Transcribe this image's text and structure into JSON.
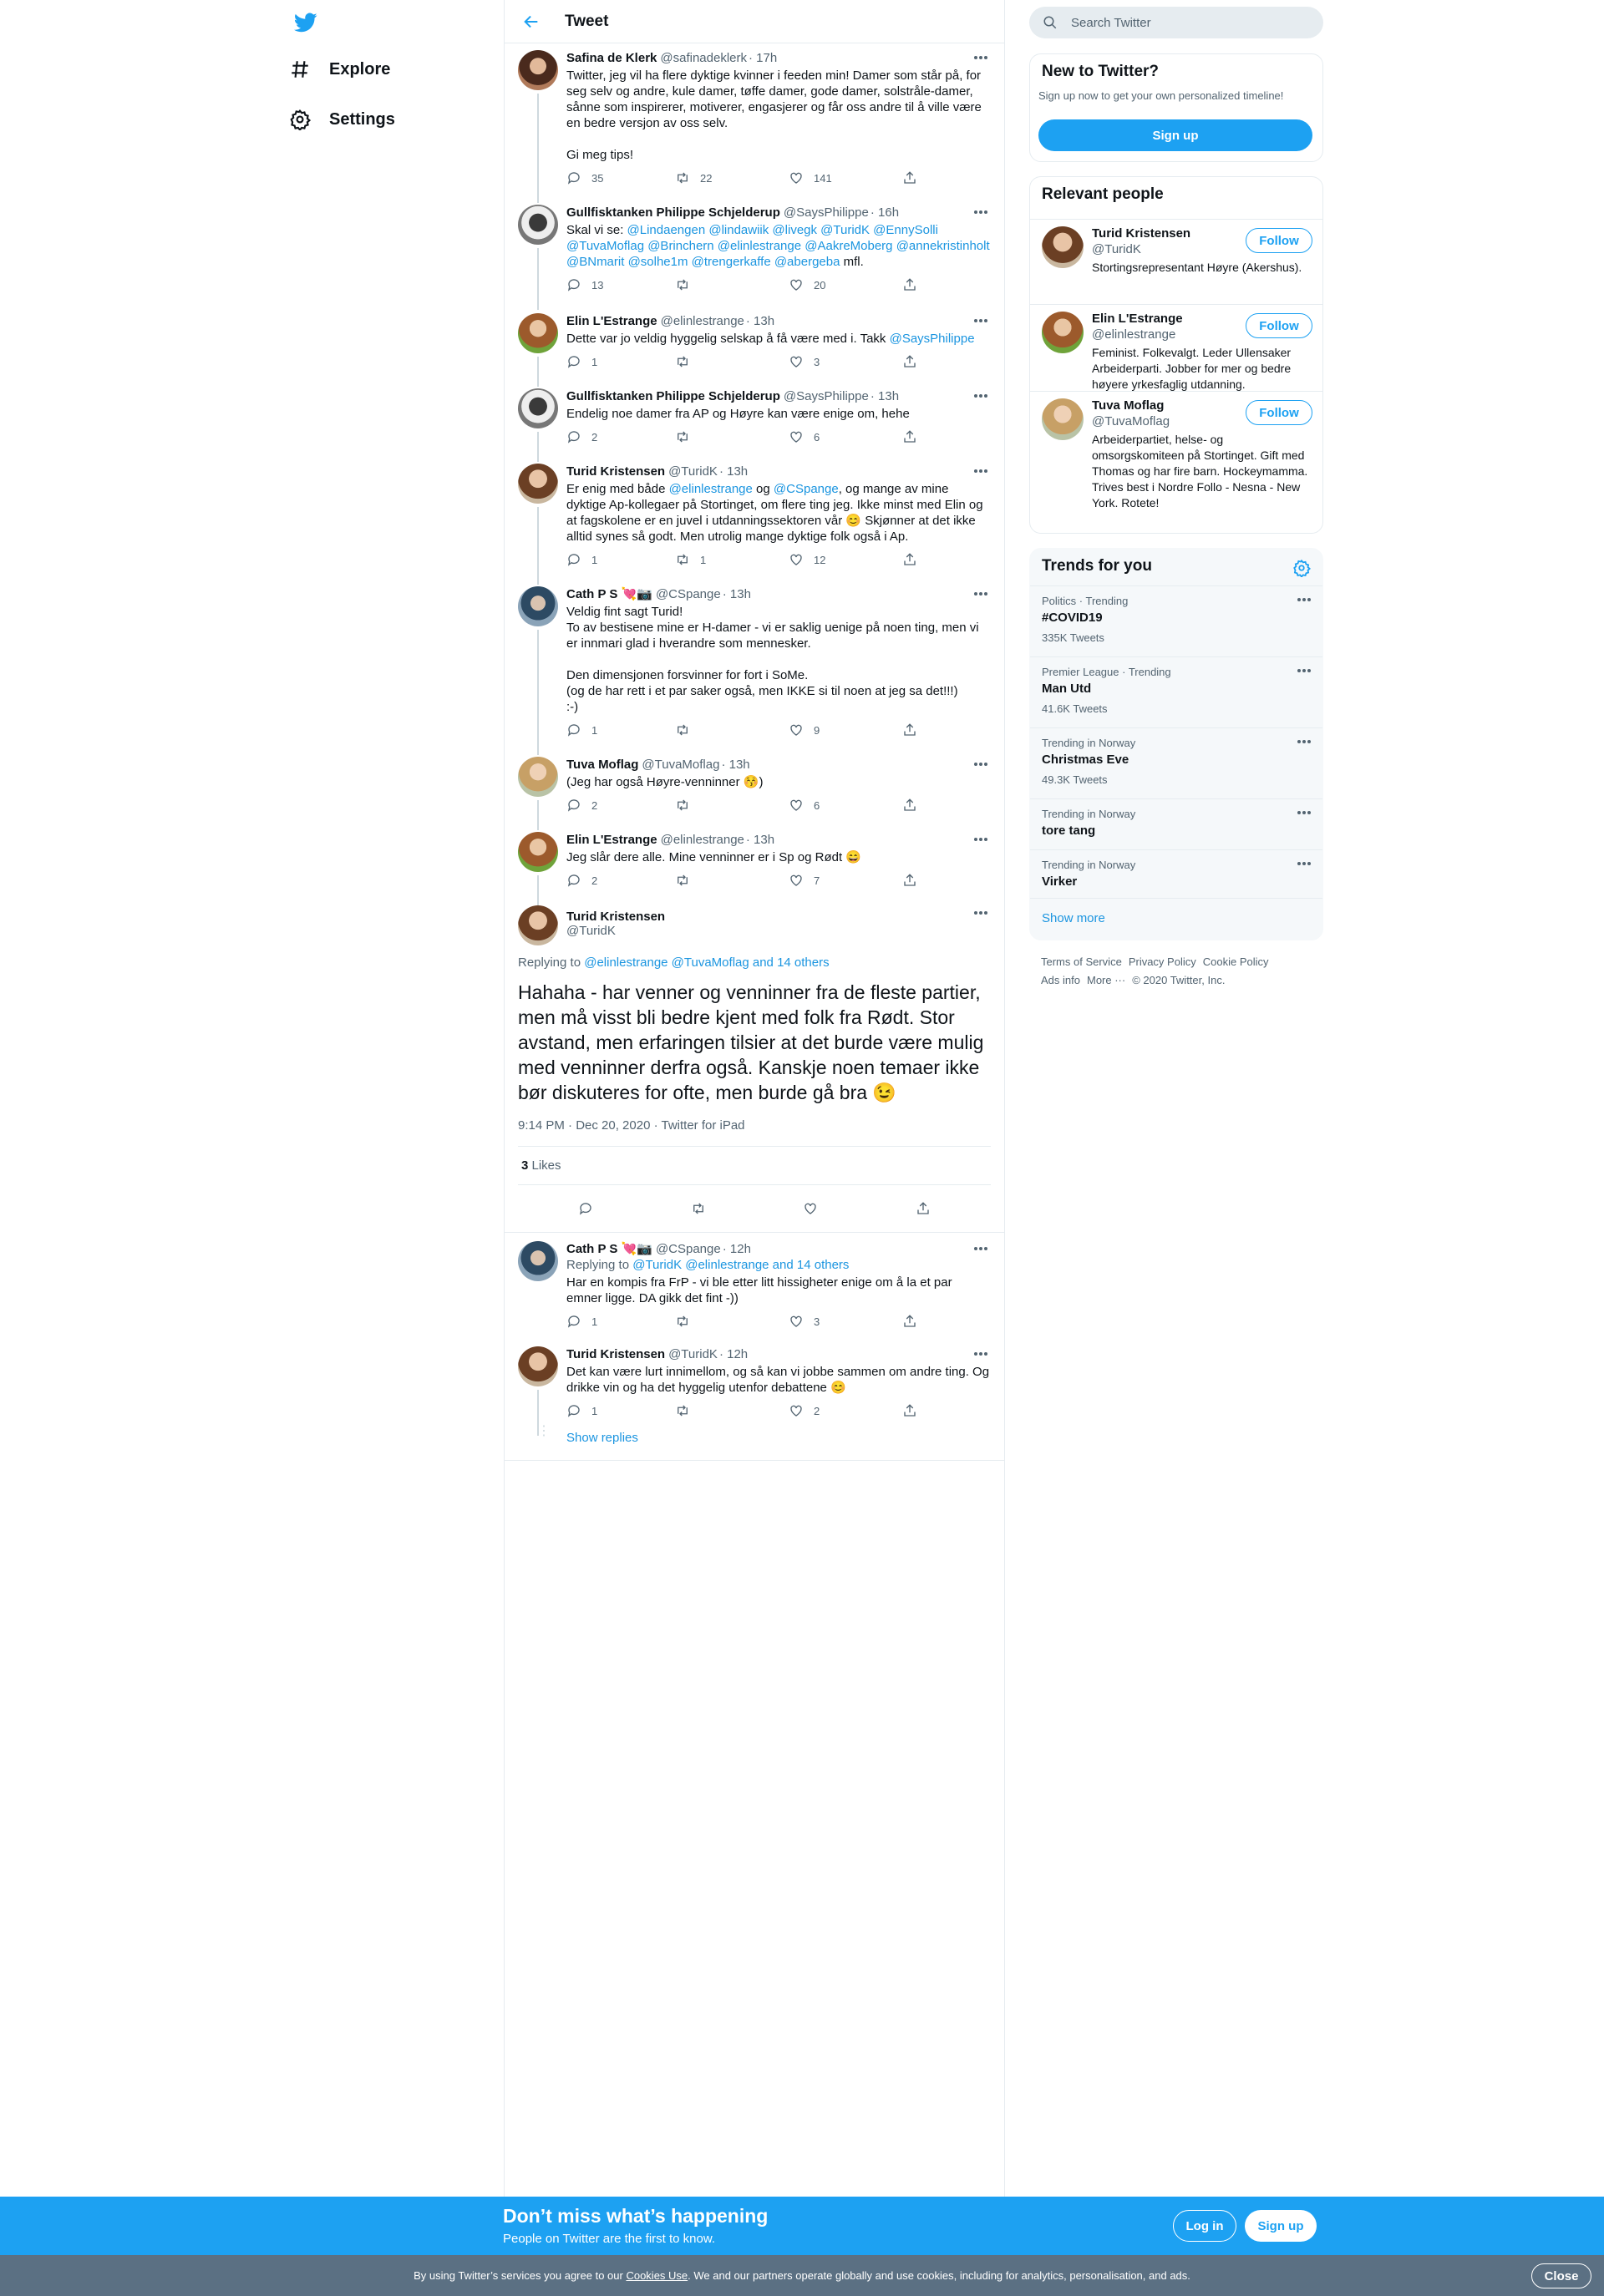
{
  "nav": {
    "explore": "Explore",
    "settings": "Settings"
  },
  "header": {
    "title": "Tweet"
  },
  "thread": [
    {
      "name": "Safina de Klerk",
      "handle": "@safinadeklerk",
      "time": "· 17h",
      "text": "Twitter, jeg vil ha flere dyktige kvinner i feeden min! Damer som står på, for seg selv og andre, kule damer, tøffe damer, gode damer, solstråle-damer, sånne som inspirerer, motiverer, engasjerer og får oss andre til å ville være en bedre versjon av oss selv.\n\nGi meg tips!",
      "replies": "35",
      "retweets": "22",
      "likes": "141"
    },
    {
      "name": "Gullfisktanken Philippe Schjelderup",
      "handle": "@SaysPhilippe",
      "time": "· 16h",
      "text_pre": "Skal vi se: ",
      "text_links": "@Lindaengen @lindawiik @livegk @TuridK @EnnySolli @TuvaMoflag @Brinchern @elinlestrange @AakreMoberg @annekristinholt @BNmarit @solhe1m @trengerkaffe @abergeba",
      "text_post": " mfl.",
      "replies": "13",
      "retweets": "",
      "likes": "20"
    },
    {
      "name": "Elin L'Estrange",
      "handle": "@elinlestrange",
      "time": "· 13h",
      "text_pre": "Dette var jo veldig hyggelig selskap å få være med i. Takk ",
      "text_link": "@SaysPhilippe",
      "replies": "1",
      "retweets": "",
      "likes": "3"
    },
    {
      "name": "Gullfisktanken Philippe Schjelderup",
      "handle": "@SaysPhilippe",
      "time": "· 13h",
      "text": "Endelig noe damer fra AP og Høyre kan være enige om, hehe",
      "replies": "2",
      "retweets": "",
      "likes": "6"
    },
    {
      "name": "Turid Kristensen",
      "handle": "@TuridK",
      "time": "· 13h",
      "text_a": "Er enig med både ",
      "link_a": "@elinlestrange",
      "text_b": " og ",
      "link_b": "@CSpange",
      "text_c": ", og mange av mine dyktige Ap-kollegaer på Stortinget, om flere ting jeg. Ikke minst med Elin og at fagskolene er en juvel i utdanningssektoren vår 😊 Skjønner at det ikke alltid synes så godt. Men utrolig mange dyktige folk også i Ap.",
      "replies": "1",
      "retweets": "1",
      "likes": "12"
    },
    {
      "name": "Cath P S 💘📷",
      "handle": "@CSpange",
      "time": "· 13h",
      "text": "Veldig fint sagt Turid!\nTo av bestisene mine er H-damer - vi er saklig uenige på noen ting, men vi er innmari glad i hverandre som mennesker.\n\nDen dimensjonen forsvinner for fort i SoMe.\n(og de har rett i et par saker også, men IKKE si til noen at jeg sa det!!!)\n:-)",
      "replies": "1",
      "retweets": "",
      "likes": "9"
    },
    {
      "name": "Tuva Moflag",
      "handle": "@TuvaMoflag",
      "time": "· 13h",
      "text": "(Jeg har også Høyre-venninner 😚)",
      "replies": "2",
      "retweets": "",
      "likes": "6"
    },
    {
      "name": "Elin L'Estrange",
      "handle": "@elinlestrange",
      "time": "· 13h",
      "text": "Jeg slår dere alle. Mine venninner er i Sp og Rødt 😄",
      "replies": "2",
      "retweets": "",
      "likes": "7"
    }
  ],
  "focus": {
    "name": "Turid Kristensen",
    "handle": "@TuridK",
    "replying_label": "Replying to ",
    "replying_links": "@elinlestrange @TuvaMoflag and 14 others",
    "text": "Hahaha - har venner og venninner fra de fleste partier, men må visst bli bedre kjent med folk fra Rødt. Stor avstand, men erfaringen tilsier at det burde være mulig med venninner derfra også. Kanskje noen temaer ikke bør diskuteres for ofte, men burde gå bra 😉",
    "timestamp": "9:14 PM · Dec 20, 2020 · Twitter for iPad",
    "likes_count": "3",
    "likes_label": " Likes"
  },
  "replies": [
    {
      "name": "Cath P S 💘📷",
      "handle": "@CSpange",
      "time": "· 12h",
      "replying_label": "Replying to ",
      "replying_links": "@TuridK @elinlestrange and 14 others",
      "text": "Har en kompis fra FrP - vi ble etter litt hissigheter enige om å la et par emner ligge. DA gikk det fint -))",
      "replies": "1",
      "retweets": "",
      "likes": "3"
    },
    {
      "name": "Turid Kristensen",
      "handle": "@TuridK",
      "time": "· 12h",
      "text": "Det kan være lurt innimellom, og så kan vi jobbe sammen om andre ting. Og drikke vin og ha det hyggelig utenfor debattene 😊",
      "replies": "1",
      "retweets": "",
      "likes": "2"
    }
  ],
  "show_replies": "Show replies",
  "search": {
    "placeholder": "Search Twitter"
  },
  "new_to_twitter": {
    "title": "New to Twitter?",
    "subtitle": "Sign up now to get your own personalized timeline!",
    "button": "Sign up"
  },
  "relevant": {
    "title": "Relevant people",
    "people": [
      {
        "name": "Turid Kristensen",
        "handle": "@TuridK",
        "bio": "Stortingsrepresentant Høyre (Akershus).",
        "button": "Follow"
      },
      {
        "name": "Elin L'Estrange",
        "handle": "@elinlestrange",
        "bio": "Feminist. Folkevalgt. Leder Ullensaker Arbeiderparti. Jobber for mer og bedre høyere yrkesfaglig utdanning.",
        "button": "Follow"
      },
      {
        "name": "Tuva Moflag",
        "handle": "@TuvaMoflag",
        "bio": "Arbeiderpartiet, helse- og omsorgskomiteen på Stortinget. Gift med Thomas og har fire barn. Hockeymamma. Trives best i Nordre Follo - Nesna - New York. Rotete!",
        "button": "Follow"
      }
    ]
  },
  "trends": {
    "title": "Trends for you",
    "items": [
      {
        "context": "Politics · Trending",
        "name": "#COVID19",
        "count": "335K Tweets"
      },
      {
        "context": "Premier League · Trending",
        "name": "Man Utd",
        "count": "41.6K Tweets"
      },
      {
        "context": "Trending in Norway",
        "name": "Christmas Eve",
        "count": "49.3K Tweets"
      },
      {
        "context": "Trending in Norway",
        "name": "tore tang",
        "count": ""
      },
      {
        "context": "Trending in Norway",
        "name": "Virker",
        "count": ""
      }
    ],
    "show_more": "Show more"
  },
  "footer": {
    "terms": "Terms of Service",
    "privacy": "Privacy Policy",
    "cookie": "Cookie Policy",
    "ads": "Ads info",
    "more": "More ···",
    "copyright": "© 2020 Twitter, Inc."
  },
  "banner": {
    "title": "Don’t miss what’s happening",
    "subtitle": "People on Twitter are the first to know.",
    "login": "Log in",
    "signup": "Sign up"
  },
  "cookie": {
    "text_pre": "By using Twitter’s services you agree to our ",
    "link": "Cookies Use",
    "text_post": ". We and our partners operate globally and use cookies, including for analytics, personalisation, and ads.",
    "close": "Close"
  },
  "colors": {
    "accent": "#1da1f2",
    "link": "#1b95e0",
    "secondary_text": "#536471",
    "banner": "#1da1f2",
    "cookie_bar": "#5b7083"
  }
}
